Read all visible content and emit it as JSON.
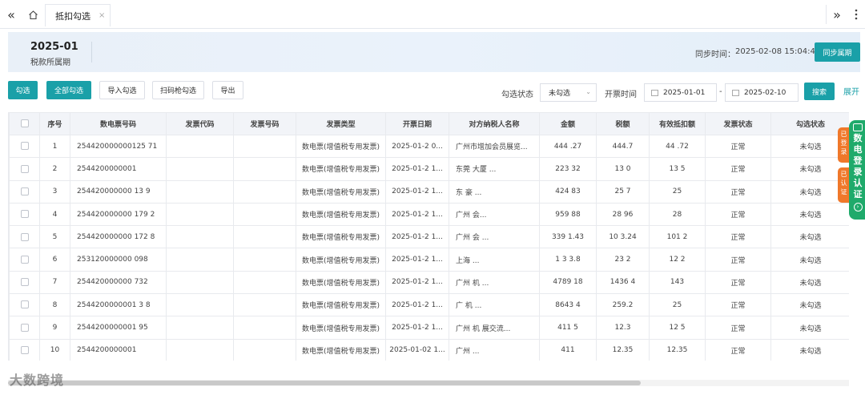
{
  "tabs": {
    "active_label": "抵扣勾选",
    "close": "×"
  },
  "header": {
    "period_value": "2025-01",
    "period_label": "税款所属期",
    "sync_label": "同步时间：",
    "sync_time": "2025-02-08 15:04:45",
    "sync_button": "同步属期"
  },
  "toolbar": {
    "select_btn": "勾选",
    "select_all_btn": "全部勾选",
    "import_btn": "导入勾选",
    "scan_btn": "扫码枪勾选",
    "export_btn": "导出",
    "status_label": "勾选状态",
    "status_value": "未勾选",
    "date_label": "开票时间",
    "date_from": "2025-01-01",
    "date_sep": "-",
    "date_to": "2025-02-10",
    "search_btn": "搜索",
    "expand_link": "展开"
  },
  "table": {
    "headers": [
      "序号",
      "数电票号码",
      "发票代码",
      "发票号码",
      "发票类型",
      "开票日期",
      "对方纳税人名称",
      "金额",
      "税额",
      "有效抵扣额",
      "发票状态",
      "勾选状态"
    ],
    "rows": [
      [
        "1",
        "254420000000125 71",
        "",
        "",
        "数电票(增值税专用发票)",
        "2025-01-2 0...",
        "广州市增加会员展览...",
        "444 .27",
        "444.7",
        "44 .72",
        "正常",
        "未勾选"
      ],
      [
        "2",
        "2544200000001",
        "",
        "",
        "数电票(增值税专用发票)",
        "2025-01-2 1...",
        "东莞 大厦 ...",
        "223 32",
        "13 0",
        "13 5",
        "正常",
        "未勾选"
      ],
      [
        "3",
        "254420000000 13 9",
        "",
        "",
        "数电票(增值税专用发票)",
        "2025-01-2 1...",
        "东 豪 ...",
        "424 83",
        "25 7",
        "25 ",
        "正常",
        "未勾选"
      ],
      [
        "4",
        "254420000000 179 2",
        "",
        "",
        "数电票(增值税专用发票)",
        "2025-01-2 1...",
        "广州 会...",
        "959 88",
        "28 96",
        "28 ",
        "正常",
        "未勾选"
      ],
      [
        "5",
        "254420000000 172 8",
        "",
        "",
        "数电票(增值税专用发票)",
        "2025-01-2 1...",
        "广州 会 ...",
        "339 1.43",
        "10 3.24",
        "101 2",
        "正常",
        "未勾选"
      ],
      [
        "6",
        "253120000000 098",
        "",
        "",
        "数电票(增值税专用发票)",
        "2025-01-2 1...",
        "上海 ...",
        "1 3 3.8",
        "23 2",
        "12 2",
        "正常",
        "未勾选"
      ],
      [
        "7",
        "254420000000 732",
        "",
        "",
        "数电票(增值税专用发票)",
        "2025-01-2 1...",
        "广州 机 ...",
        "4789 18",
        "1436 4",
        "143 ",
        "正常",
        "未勾选"
      ],
      [
        "8",
        "2544200000001 3 8",
        "",
        "",
        "数电票(增值税专用发票)",
        "2025-01-2 1...",
        "广 机 ...",
        "8643 4",
        "259.2",
        "25 ",
        "正常",
        "未勾选"
      ],
      [
        "9",
        "2544200000001 95",
        "",
        "",
        "数电票(增值税专用发票)",
        "2025-01-2 1...",
        "广州 机 展交流...",
        "411 5",
        "12.3",
        "12 5",
        "正常",
        "未勾选"
      ],
      [
        "10",
        "2544200000001",
        "",
        "",
        "数电票(增值税专用发票)",
        "2025-01-02 1...",
        "广州 ...",
        "411",
        "12.35",
        "12.35",
        "正常",
        "未勾选"
      ]
    ]
  },
  "side_widgets": {
    "green_text": [
      "数",
      "电",
      "登",
      "录",
      "认",
      "证"
    ],
    "orange_top": [
      "已",
      "登",
      "录"
    ],
    "orange_bottom": [
      "已",
      "认",
      "证"
    ]
  },
  "watermark": "大数跨境",
  "colors": {
    "primary": "#1aa0a8",
    "green": "#1faa6b",
    "orange": "#f0782a"
  },
  "icons": [
    "double-left-icon",
    "home-icon",
    "double-right-icon",
    "calendar-icon",
    "chevron-down-icon"
  ]
}
